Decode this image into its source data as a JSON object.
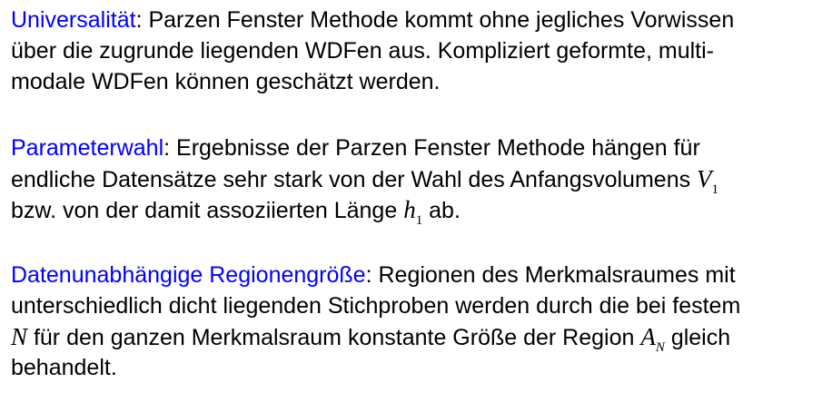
{
  "sections": [
    {
      "term": "Universalität",
      "lines": [
        ": Parzen Fenster Methode kommt ohne jegliches Vorwissen",
        "über die zugrunde liegenden WDFen aus. Kompliziert geformte, multi-",
        "modale WDFen können geschätzt werden."
      ]
    },
    {
      "term": "Parameterwahl",
      "lines": [
        ": Ergebnisse der Parzen Fenster Methode hängen für",
        "endliche Datensätze sehr stark von der Wahl des Anfangsvolumens ",
        "bzw. von der damit assoziierten Länge ",
        " ab."
      ],
      "math": [
        {
          "symbol": "V",
          "subscript": "1"
        },
        {
          "symbol": "h",
          "subscript": "1"
        }
      ]
    },
    {
      "term": "Datenunabhängige Regionengröße",
      "lines": [
        ": Regionen des Merkmalsraumes mit",
        "unterschiedlich dicht liegenden Stichproben werden durch die bei festem",
        " für den ganzen Merkmalsraum konstante Größe der Region ",
        " gleich",
        "behandelt."
      ],
      "math": [
        {
          "symbol": "N"
        },
        {
          "symbol": "A",
          "subscript": "N"
        }
      ]
    }
  ]
}
